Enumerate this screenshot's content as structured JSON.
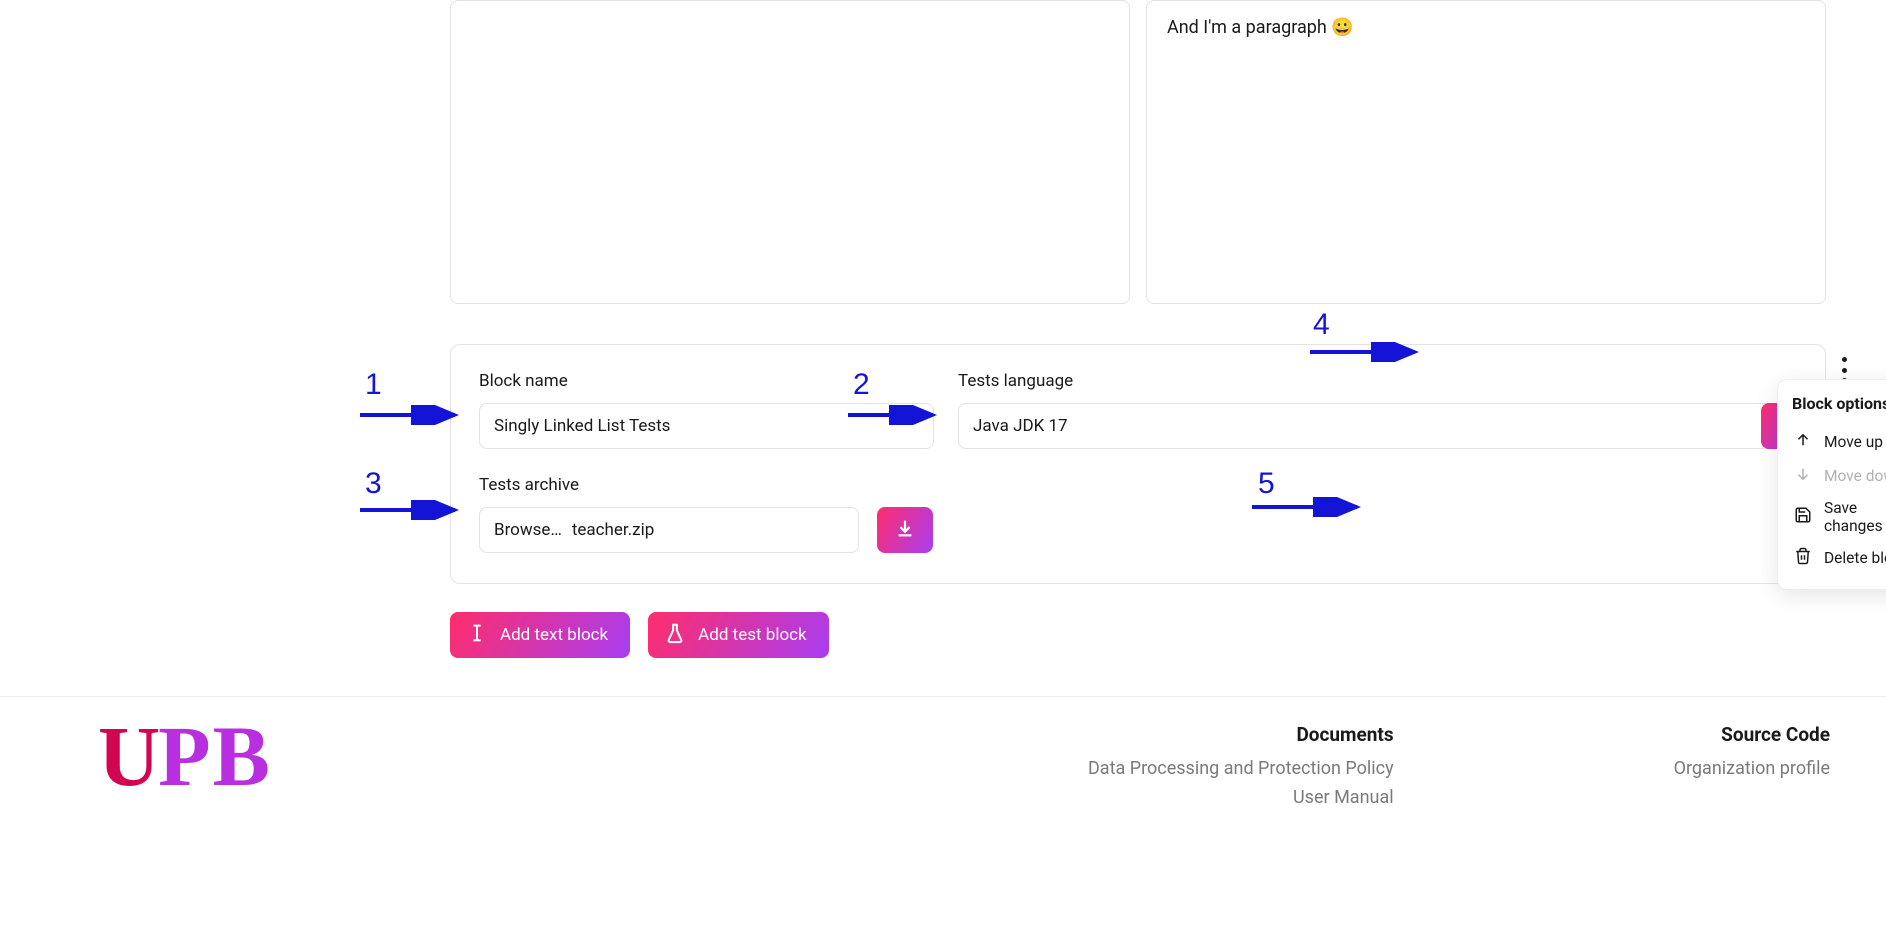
{
  "preview": {
    "paragraph_text": "And I'm a paragraph ",
    "emoji": "😀"
  },
  "block": {
    "name_label": "Block name",
    "name_value": "Singly Linked List Tests",
    "lang_label": "Tests language",
    "lang_value": "Java JDK 17",
    "archive_label": "Tests archive",
    "browse_label": "Browse…",
    "archive_file": "teacher.zip"
  },
  "popover": {
    "title": "Block options",
    "move_up": "Move up",
    "move_down": "Move down",
    "save": "Save changes",
    "delete": "Delete block"
  },
  "buttons": {
    "add_text": "Add text block",
    "add_test": "Add test block"
  },
  "footer": {
    "documents_title": "Documents",
    "documents_link1": "Data Processing and Protection Policy",
    "documents_link2": "User Manual",
    "source_title": "Source Code",
    "source_link1": "Organization profile"
  },
  "annotations": {
    "n1": "1",
    "n2": "2",
    "n3": "3",
    "n4": "4",
    "n5": "5"
  }
}
